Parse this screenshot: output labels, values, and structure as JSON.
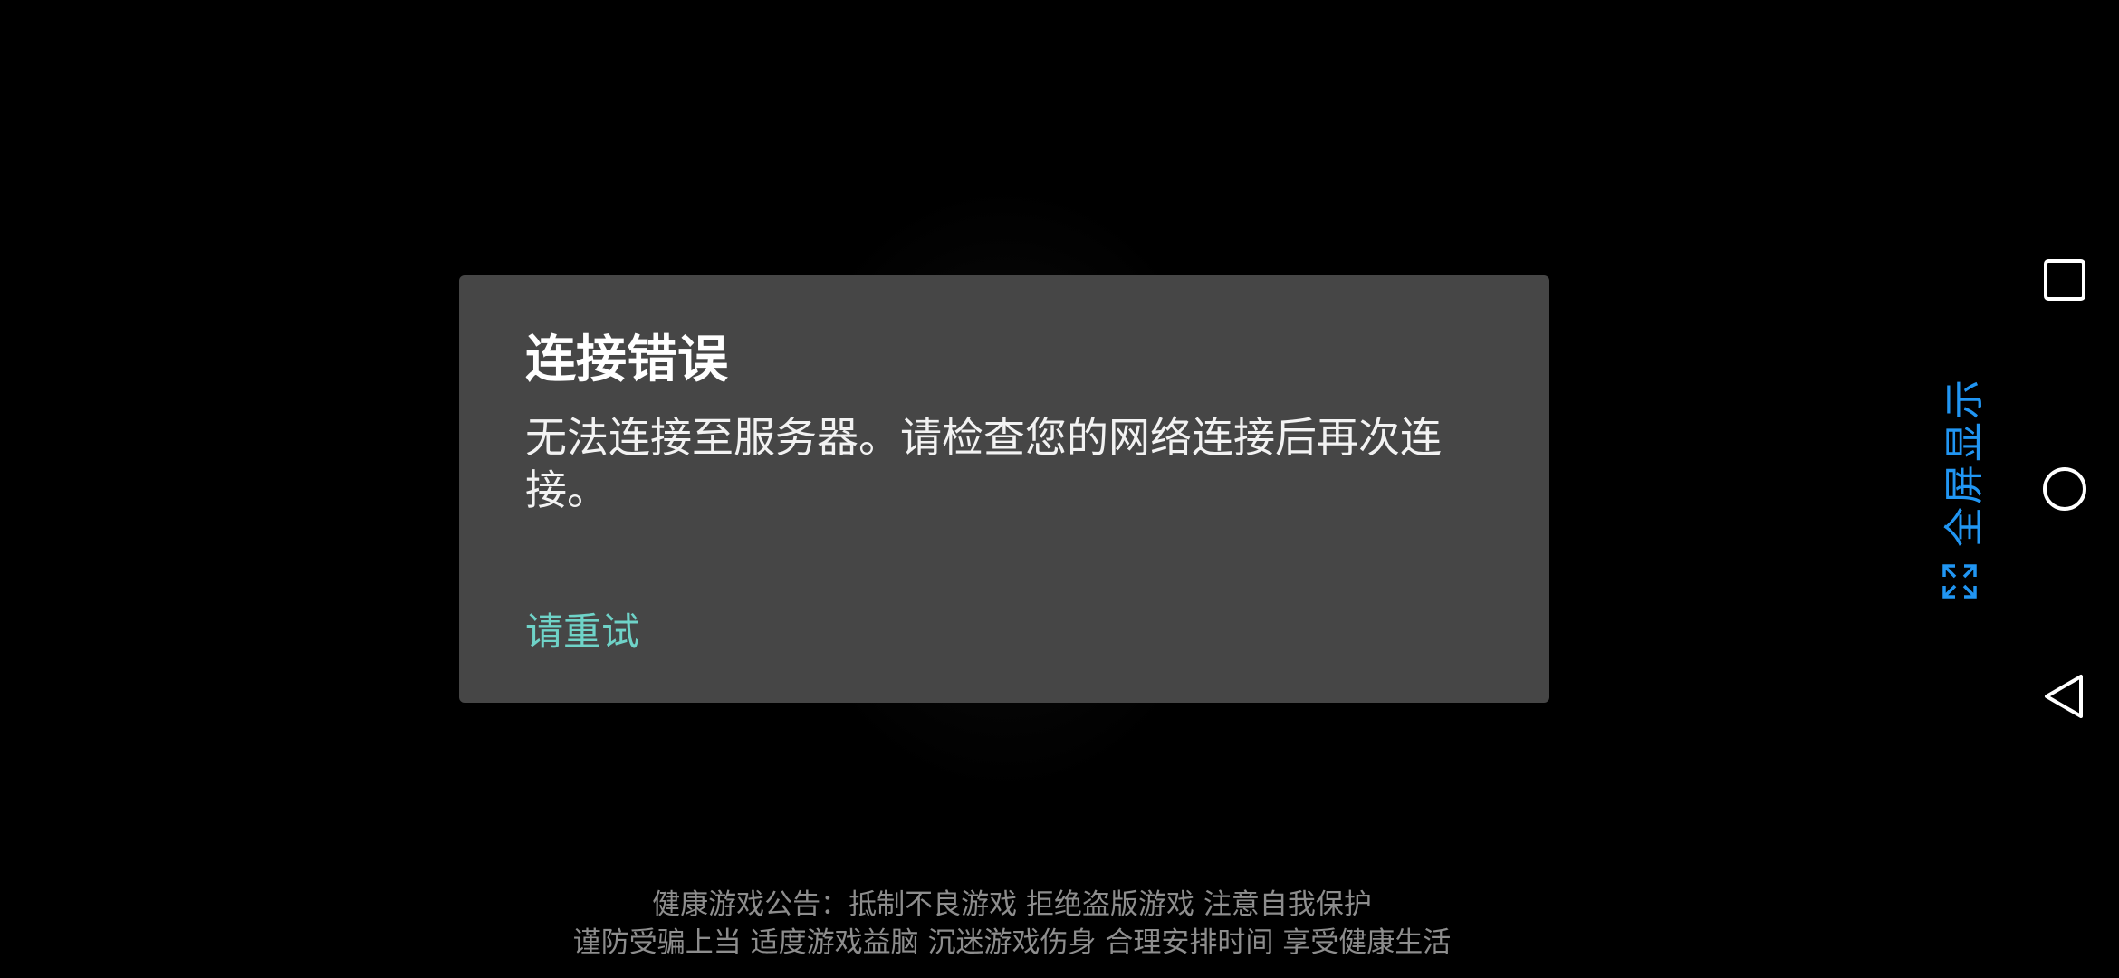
{
  "dialog": {
    "title": "连接错误",
    "message": "无法连接至服务器。请检查您的网络连接后再次连接。",
    "retry_label": "请重试"
  },
  "fullscreen": {
    "label": "全屏显示",
    "icon": "expand-icon",
    "color": "#2196f3"
  },
  "notice": {
    "line1": "健康游戏公告：抵制不良游戏  拒绝盗版游戏  注意自我保护",
    "line2": "谨防受骗上当  适度游戏益脑  沉迷游戏伤身  合理安排时间  享受健康生活"
  },
  "nav": {
    "recent_icon": "square-icon",
    "home_icon": "circle-icon",
    "back_icon": "triangle-back-icon"
  },
  "colors": {
    "dialog_bg": "#464646",
    "accent": "#6fd3c8",
    "background": "#000000"
  }
}
